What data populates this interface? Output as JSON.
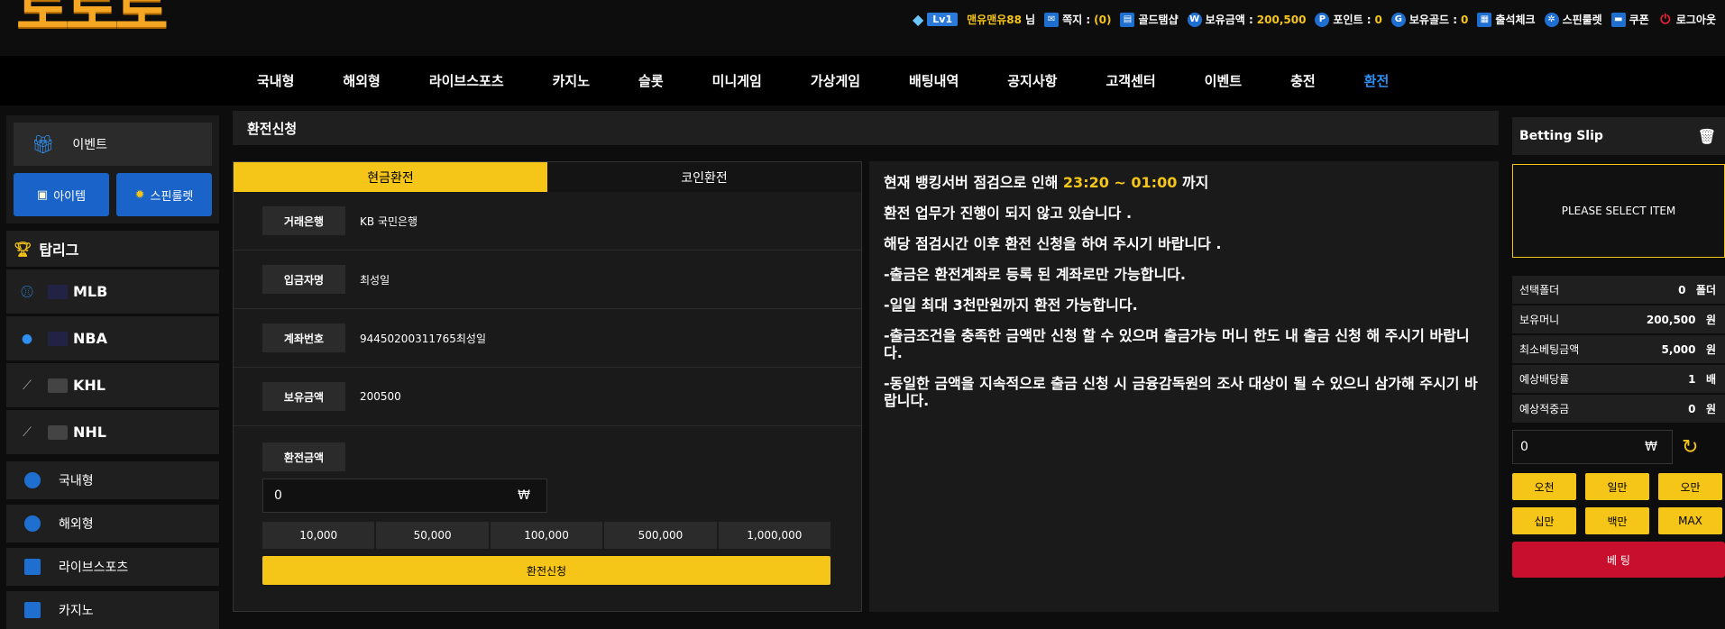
{
  "header": {
    "logo": "토토로",
    "level": "Lv1",
    "username": "맨유맨유88",
    "honorific": "님",
    "messages_label": "쪽지 :",
    "messages_count": "(0)",
    "gold_shop": "골드탬샵",
    "balance_label": "보유금액 :",
    "balance_value": "200,500",
    "points_label": "포인트 :",
    "points_value": "0",
    "gold_label": "보유골드 :",
    "gold_value": "0",
    "attendance": "출석체크",
    "spin_roulette": "스핀룰렛",
    "coupon": "쿠폰",
    "logout": "로그아웃"
  },
  "nav": [
    "국내형",
    "해외형",
    "라이브스포츠",
    "카지노",
    "슬롯",
    "미니게임",
    "가상게임",
    "배팅내역",
    "공지사항",
    "고객센터",
    "이벤트",
    "충전",
    "환전"
  ],
  "sidebar": {
    "event": "이벤트",
    "item": "아이템",
    "roulette": "스핀룰렛",
    "top_league": "탑리그",
    "leagues": [
      "MLB",
      "NBA",
      "KHL",
      "NHL"
    ],
    "menu": [
      "국내형",
      "해외형",
      "라이브스포츠",
      "카지노"
    ]
  },
  "main": {
    "title": "환전신청",
    "tabs": [
      "현금환전",
      "코인환전"
    ],
    "rows": [
      {
        "label": "거래은행",
        "value": "KB 국민은행"
      },
      {
        "label": "입금자명",
        "value": "최성일"
      },
      {
        "label": "계좌번호",
        "value": "94450200311765최성일"
      },
      {
        "label": "보유금액",
        "value": "200500"
      }
    ],
    "amount_label": "환전금액",
    "amount_value": "0",
    "currency": "₩",
    "quick": [
      "10,000",
      "50,000",
      "100,000",
      "500,000",
      "1,000,000"
    ],
    "submit": "환전신청"
  },
  "notice": {
    "line1_prefix": "현재 뱅킹서버 점검으로 인해 ",
    "line1_time": "23:20 ~ 01:00",
    "line1_suffix": " 까지",
    "lines": [
      "환전 업무가 진행이 되지 않고 있습니다 .",
      "해당 점검시간 이후 환전 신청을 하여 주시기 바랍니다 .",
      "-출금은 환전계좌로 등록 된 계좌로만 가능합니다.",
      "-일일 최대 3천만원까지 환전 가능합니다.",
      "-출금조건을 충족한 금액만 신청 할 수 있으며 출금가능 머니 한도 내 출금 신청 해 주시기 바랍니다.",
      "-동일한 금액을 지속적으로 출금 신청 시 금융감독원의 조사 대상이 될 수 있으니 삼가해 주시기 바랍니다."
    ]
  },
  "betslip": {
    "title": "Betting Slip",
    "empty": "PLEASE SELECT ITEM",
    "rows": [
      {
        "label": "선택폴더",
        "value": "0",
        "unit": "폴더"
      },
      {
        "label": "보유머니",
        "value": "200,500",
        "unit": "원"
      },
      {
        "label": "최소베팅금액",
        "value": "5,000",
        "unit": "원"
      },
      {
        "label": "예상배당률",
        "value": "1",
        "unit": "배"
      },
      {
        "label": "예상적중금",
        "value": "0",
        "unit": "원"
      }
    ],
    "input_value": "0",
    "currency": "₩",
    "amount_buttons": [
      "오천",
      "일만",
      "오만",
      "십만",
      "백만",
      "MAX"
    ],
    "bet_button": "베 팅"
  }
}
